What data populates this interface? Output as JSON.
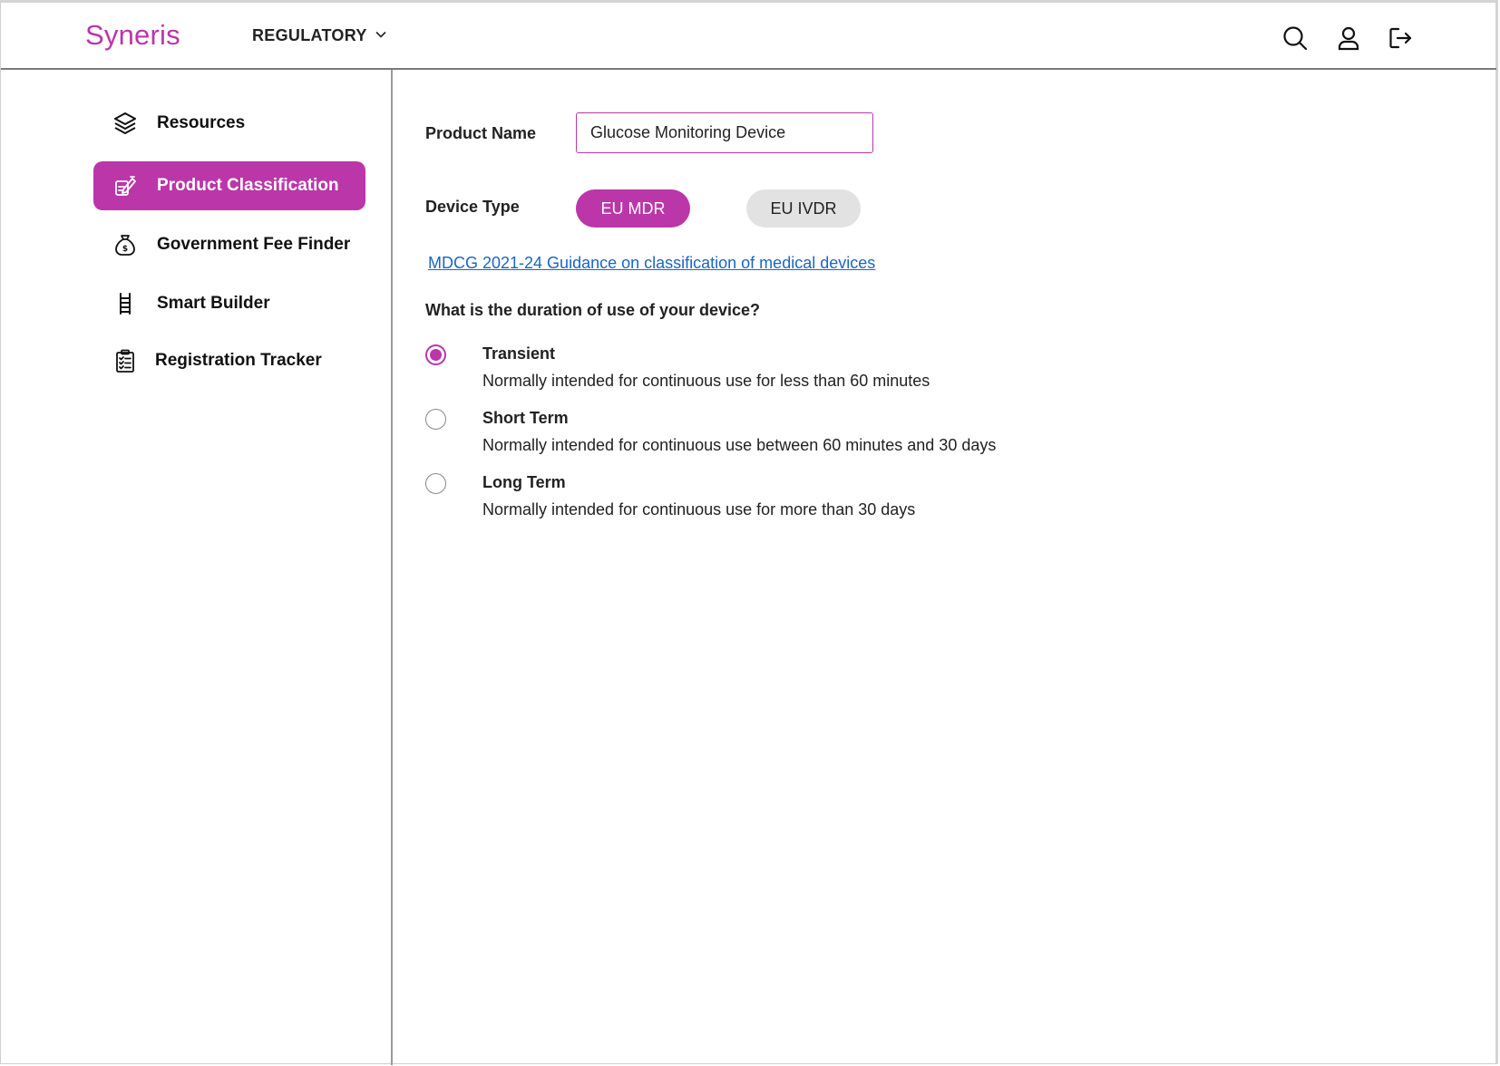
{
  "header": {
    "logo": "Syneris",
    "nav_label": "REGULATORY",
    "icons": [
      "search-icon",
      "user-icon",
      "logout-icon"
    ]
  },
  "sidebar": {
    "items": [
      {
        "label": "Resources",
        "icon": "layers-icon",
        "active": false
      },
      {
        "label": "Product Classification",
        "icon": "classification-icon",
        "active": true
      },
      {
        "label": "Government Fee Finder",
        "icon": "money-bag-icon",
        "active": false
      },
      {
        "label": "Smart Builder",
        "icon": "ladder-icon",
        "active": false
      },
      {
        "label": "Registration Tracker",
        "icon": "clipboard-icon",
        "active": false
      }
    ]
  },
  "main": {
    "product_name_label": "Product Name",
    "product_name_value": "Glucose Monitoring Device",
    "device_type_label": "Device Type",
    "device_types": [
      {
        "label": "EU MDR",
        "selected": true
      },
      {
        "label": "EU IVDR",
        "selected": false
      }
    ],
    "guidance_link": "MDCG 2021-24 Guidance on classification of medical devices",
    "question": "What is the duration of use of your device?",
    "options": [
      {
        "title": "Transient",
        "description": "Normally intended for continuous use for less than 60 minutes",
        "selected": true
      },
      {
        "title": "Short Term",
        "description": "Normally intended for continuous use between 60 minutes and 30 days",
        "selected": false
      },
      {
        "title": "Long Term",
        "description": "Normally intended for continuous use for more than 30 days",
        "selected": false
      }
    ]
  },
  "colors": {
    "accent": "#bb36a9",
    "link": "#1a66c4",
    "pill_inactive": "#e2e2e2"
  }
}
